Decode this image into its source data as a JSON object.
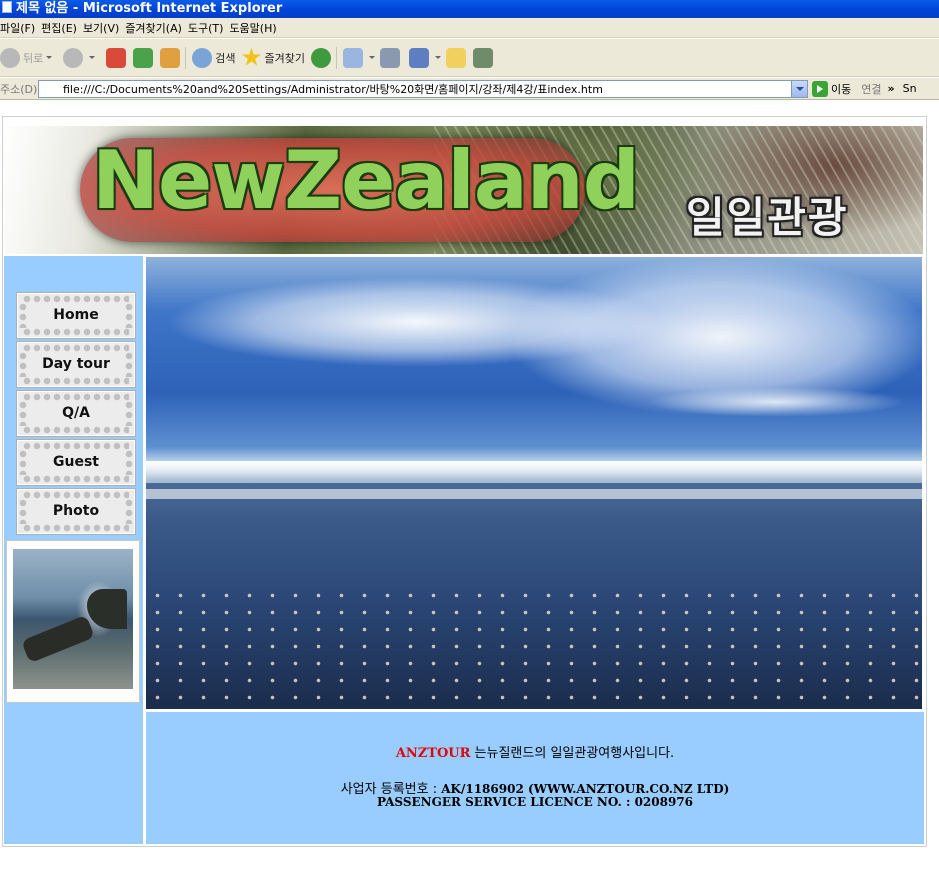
{
  "window": {
    "title": "제목 없음 - Microsoft Internet Explorer"
  },
  "menu": [
    "파일(F)",
    "편집(E)",
    "보기(V)",
    "즐겨찾기(A)",
    "도구(T)",
    "도움말(H)"
  ],
  "toolbar": {
    "back": "뒤로",
    "search": "검색",
    "favorites": "즐겨찾기"
  },
  "address": {
    "label": "주소(D)",
    "url": "file:///C:/Documents%20and%20Settings/Administrator/바탕%20화면/홈페이지/강좌/제4강/표index.htm",
    "go": "이동",
    "links": "연결",
    "more": "»",
    "snag": "Sn"
  },
  "banner": {
    "title": "NewZealand",
    "subtitle": "일일관광"
  },
  "nav": [
    "Home",
    "Day tour",
    "Q/A",
    "Guest",
    "Photo"
  ],
  "footer": {
    "brand": "ANZTOUR",
    "line1_rest": " 는뉴질랜드의 일일관광여행사입니다.",
    "line2_prefix": "사업자 등록번호 : ",
    "line2_bold": "AK/1186902 (WWW.ANZTOUR.CO.NZ LTD)",
    "line3": "PASSENGER SERVICE LICENCE NO. : 0208976"
  },
  "colors": {
    "sidebar_bg": "#99ccff",
    "footer_bg": "#99ccff",
    "brand_red": "#e00000",
    "titlebar": "#0045d8"
  }
}
